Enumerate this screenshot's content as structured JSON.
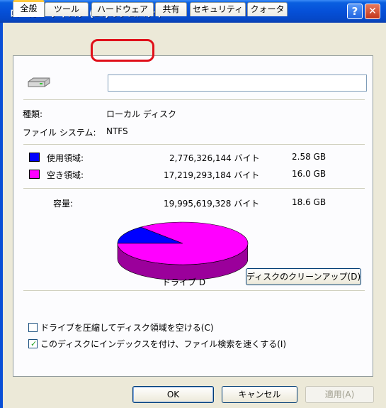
{
  "window": {
    "title": "ローカル ディスク (D:)のプロパティ",
    "help_glyph": "?",
    "close_glyph": "✕"
  },
  "tabs": [
    {
      "label": "全般",
      "active": true
    },
    {
      "label": "ツール",
      "active": false
    },
    {
      "label": "ハードウェア",
      "active": false,
      "highlighted": true
    },
    {
      "label": "共有",
      "active": false
    },
    {
      "label": "セキュリティ",
      "active": false
    },
    {
      "label": "クォータ",
      "active": false
    }
  ],
  "general": {
    "volume_label_value": "",
    "type_label": "種類:",
    "type_value": "ローカル ディスク",
    "fs_label": "ファイル システム:",
    "fs_value": "NTFS",
    "used_label": "使用領域:",
    "used_bytes": "2,776,326,144 バイト",
    "used_size": "2.58 GB",
    "free_label": "空き領域:",
    "free_bytes": "17,219,293,184 バイト",
    "free_size": "16.0 GB",
    "capacity_label": "容量:",
    "capacity_bytes": "19,995,619,328 バイト",
    "capacity_size": "18.6 GB",
    "drive_label": "ドライブ D",
    "cleanup_button": "ディスクのクリーンアップ(D)",
    "compress_checkbox": "ドライブを圧縮してディスク領域を空ける(C)",
    "compress_checked": false,
    "index_checkbox": "このディスクにインデックスを付け、ファイル検索を速くする(I)",
    "index_checked": true
  },
  "colors": {
    "used": "#0000ff",
    "free": "#ff00ff",
    "highlight": "#e0101a"
  },
  "chart_data": {
    "type": "pie",
    "slices": [
      {
        "label": "使用領域",
        "value": 2776326144,
        "color": "#0000ff"
      },
      {
        "label": "空き領域",
        "value": 17219293184,
        "color": "#ff00ff"
      }
    ]
  },
  "footer": {
    "ok": "OK",
    "cancel": "キャンセル",
    "apply": "適用(A)"
  }
}
